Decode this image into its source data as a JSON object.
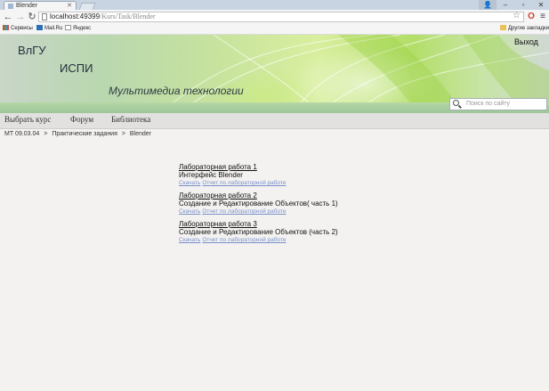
{
  "browser": {
    "tab_title": "Blender",
    "url_host": "localhost:49399",
    "url_path": "/Kurs/Task/Blender",
    "bookmarks": [
      "Сервисы",
      "Mail.Ru",
      "Яндекс"
    ],
    "other_bookmarks": "Другие закладки"
  },
  "site": {
    "org": "ВлГУ",
    "dept": "ИСПИ",
    "tagline": "Мультимедиа технологии",
    "logout": "Выход",
    "search_placeholder": "Поиск по сайту"
  },
  "menu": [
    "Выбрать курс",
    "Форум",
    "Библиотека"
  ],
  "breadcrumb": [
    "МТ 09.03.04",
    ">",
    "Практические задания",
    ">",
    "Blender"
  ],
  "labs": [
    {
      "title": "Лабораторная работа 1",
      "subtitle": "Интерфейс Blender",
      "download": "Скачать",
      "report": "Отчет по лабораторной работе"
    },
    {
      "title": "Лабораторная работа 2",
      "subtitle": "Создание и Редактирование Объектов( часть 1)",
      "download": "Скачать",
      "report": "Отчет по лабораторной работе"
    },
    {
      "title": "Лабораторная работа 3",
      "subtitle": "Создание и Редактирование Объектов (часть 2)",
      "download": "Скачать",
      "report": "Отчет по лабораторной работе"
    }
  ],
  "colors": {
    "link": "#7a90c9",
    "menubar": "#e2e1df",
    "page_bg": "#f3f2f1"
  }
}
